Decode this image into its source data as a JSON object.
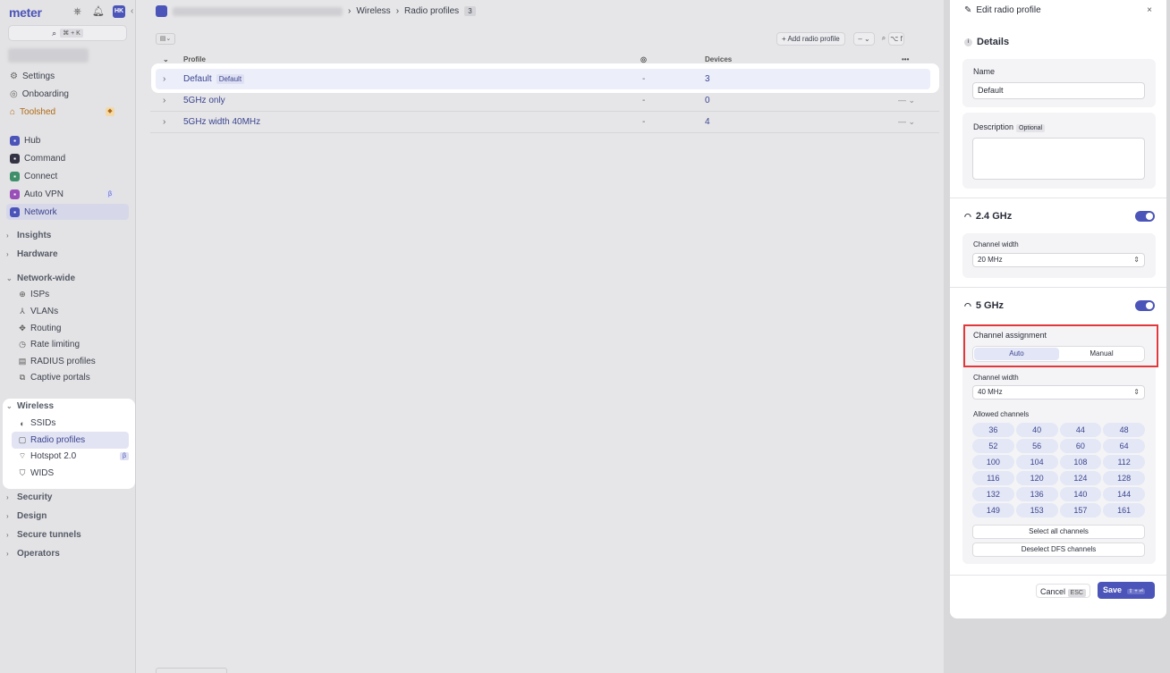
{
  "brand": {
    "logo": "meter",
    "avatar_initials": "HK"
  },
  "sidebar": {
    "search_shortcut": "⌘ + K",
    "top": [
      {
        "label": "Settings"
      },
      {
        "label": "Onboarding"
      },
      {
        "label": "Toolshed"
      }
    ],
    "apps": [
      {
        "label": "Hub",
        "color": "#4b54b8"
      },
      {
        "label": "Command",
        "color": "#333344"
      },
      {
        "label": "Connect",
        "color": "#3f8f6a"
      },
      {
        "label": "Auto VPN",
        "color": "#9a4fb8",
        "beta": "β"
      },
      {
        "label": "Network",
        "color": "#4b54b8"
      }
    ],
    "sections": {
      "insights": "Insights",
      "hardware": "Hardware",
      "network_wide": "Network-wide",
      "wireless": "Wireless",
      "security": "Security",
      "design": "Design",
      "secure_tunnels": "Secure tunnels",
      "operators": "Operators"
    },
    "network_wide_items": [
      "ISPs",
      "VLANs",
      "Routing",
      "Rate limiting",
      "RADIUS profiles",
      "Captive portals"
    ],
    "wireless_items": [
      {
        "label": "SSIDs"
      },
      {
        "label": "Radio profiles"
      },
      {
        "label": "Hotspot 2.0",
        "beta": "β"
      },
      {
        "label": "WIDS"
      }
    ]
  },
  "breadcrumb": {
    "section": "Wireless",
    "page": "Radio profiles",
    "count": "3"
  },
  "toolbar": {
    "add_label": "+ Add radio profile",
    "dash_menu": "– ⌄",
    "search_keys": "⌥ f"
  },
  "table": {
    "headers": {
      "profile": "Profile",
      "devices": "Devices",
      "more": "•••"
    },
    "rows": [
      {
        "name": "Default",
        "tag": "Default",
        "ssids": "-",
        "devices": "3",
        "actions": ""
      },
      {
        "name": "5GHz only",
        "tag": "",
        "ssids": "-",
        "devices": "0",
        "actions": "— ⌄"
      },
      {
        "name": "5GHz width 40MHz",
        "tag": "",
        "ssids": "-",
        "devices": "4",
        "actions": "— ⌄"
      }
    ]
  },
  "drawer": {
    "title": "Edit radio profile",
    "close": "×",
    "details_title": "Details",
    "name_label": "Name",
    "name_value": "Default",
    "description_label": "Description",
    "optional_tag": "Optional",
    "band_24": {
      "title": "2.4 GHz",
      "enabled": true,
      "channel_width_label": "Channel width",
      "channel_width_value": "20 MHz"
    },
    "band_5": {
      "title": "5 GHz",
      "enabled": true,
      "channel_assignment_label": "Channel assignment",
      "assignment_options": [
        "Auto",
        "Manual"
      ],
      "assignment_selected": "Auto",
      "channel_width_label": "Channel width",
      "channel_width_value": "40 MHz",
      "allowed_channels_label": "Allowed channels",
      "channels": [
        "36",
        "40",
        "44",
        "48",
        "52",
        "56",
        "60",
        "64",
        "100",
        "104",
        "108",
        "112",
        "116",
        "120",
        "124",
        "128",
        "132",
        "136",
        "140",
        "144",
        "149",
        "153",
        "157",
        "161"
      ],
      "select_all": "Select all channels",
      "deselect_dfs": "Deselect DFS channels"
    },
    "cancel_label": "Cancel",
    "cancel_key": "ESC",
    "save_label": "Save",
    "save_keys": "⇧ + ⏎"
  },
  "colors": {
    "accent": "#4b54b8",
    "highlight": "#e0383b"
  }
}
